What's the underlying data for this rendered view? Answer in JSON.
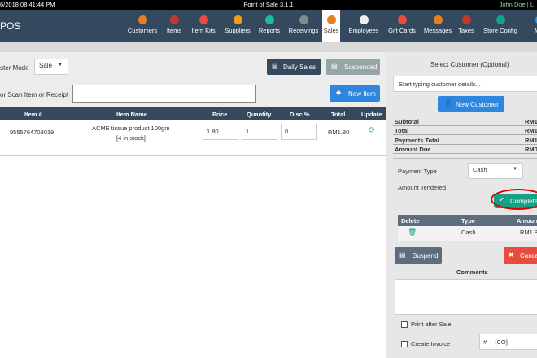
{
  "topbar": {
    "datetime": "6/2018 08:41:44 PM",
    "title": "Point of Sale 3.1.1",
    "user": "John Doe | L"
  },
  "brand": "POS",
  "nav": [
    {
      "label": "Customers",
      "color": "#e67e22"
    },
    {
      "label": "Items",
      "color": "#c0392b"
    },
    {
      "label": "Item Kits",
      "color": "#e74c3c"
    },
    {
      "label": "Suppliers",
      "color": "#f39c12"
    },
    {
      "label": "Reports",
      "color": "#1abc9c"
    },
    {
      "label": "Receivings",
      "color": "#7f8c8d"
    },
    {
      "label": "Sales",
      "color": "#e67e22"
    },
    {
      "label": "Employees",
      "color": "#ecf0f1"
    },
    {
      "label": "Gift Cards",
      "color": "#e74c3c"
    },
    {
      "label": "Messages",
      "color": "#e67e22"
    },
    {
      "label": "Taxes",
      "color": "#c0392b"
    },
    {
      "label": "Store Config",
      "color": "#16a085"
    },
    {
      "label": "Mig",
      "color": "#3498db"
    }
  ],
  "register": {
    "mode_label": "ster Mode",
    "mode_value": "Sale",
    "daily_sales": "Daily Sales",
    "suspended": "Suspended",
    "scan_label": "or Scan Item or Receipt",
    "scan_value": "",
    "new_item": "New Item"
  },
  "cart": {
    "headers": [
      "Item #",
      "Item Name",
      "Price",
      "Quantity",
      "Disc %",
      "Total",
      "Update"
    ],
    "rows": [
      {
        "item_no": "9555764708019",
        "name": "ACME tissue product 100gm",
        "stock": "[4 in stock]",
        "price": "1.80",
        "qty": "1",
        "disc": "0",
        "total": "RM1.80"
      }
    ]
  },
  "customer": {
    "title": "Select Customer (Optional)",
    "placeholder": "Start typing customer details...",
    "new_customer": "New Customer"
  },
  "summary": {
    "subtotal_label": "Subtotal",
    "subtotal": "RM1",
    "total_label": "Total",
    "total": "RM1",
    "payments_label": "Payments Total",
    "payments": "RM1",
    "due_label": "Amount Due",
    "due": "RM0"
  },
  "payment": {
    "type_label": "Payment Type",
    "type_value": "Cash",
    "tendered_label": "Amount Tendered",
    "complete": "Complete",
    "headers": [
      "Delete",
      "Type",
      "Amoun"
    ],
    "row": {
      "type": "Cash",
      "amount": "RM1.8"
    }
  },
  "actions": {
    "suspend": "Suspend",
    "cancel": "Cance"
  },
  "comments": {
    "label": "Comments",
    "value": ""
  },
  "options": {
    "print_after_sale": "Print after Sale",
    "create_invoice": "Create Invoice",
    "hash": "#",
    "invoice_value": "{CO}"
  }
}
